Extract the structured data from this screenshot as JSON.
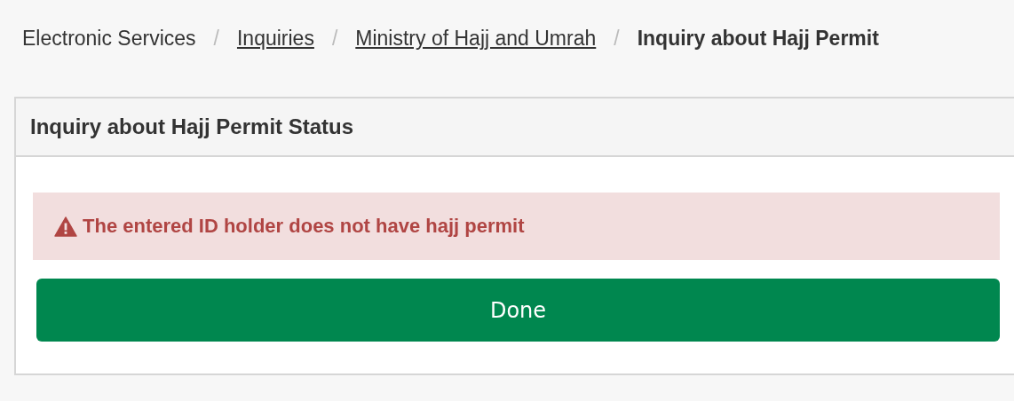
{
  "breadcrumb": [
    {
      "kind": "text",
      "label": "Electronic Services"
    },
    {
      "kind": "separator",
      "label": "/"
    },
    {
      "kind": "link",
      "label": "Inquiries"
    },
    {
      "kind": "separator",
      "label": "/"
    },
    {
      "kind": "link",
      "label": "Ministry of Hajj and Umrah"
    },
    {
      "kind": "separator",
      "label": "/"
    },
    {
      "kind": "current",
      "label": "Inquiry about Hajj Permit"
    }
  ],
  "panel": {
    "title": "Inquiry about Hajj Permit Status",
    "alert": {
      "kind": "error",
      "message": "The entered ID holder does not have hajj permit"
    },
    "button": "Done"
  }
}
